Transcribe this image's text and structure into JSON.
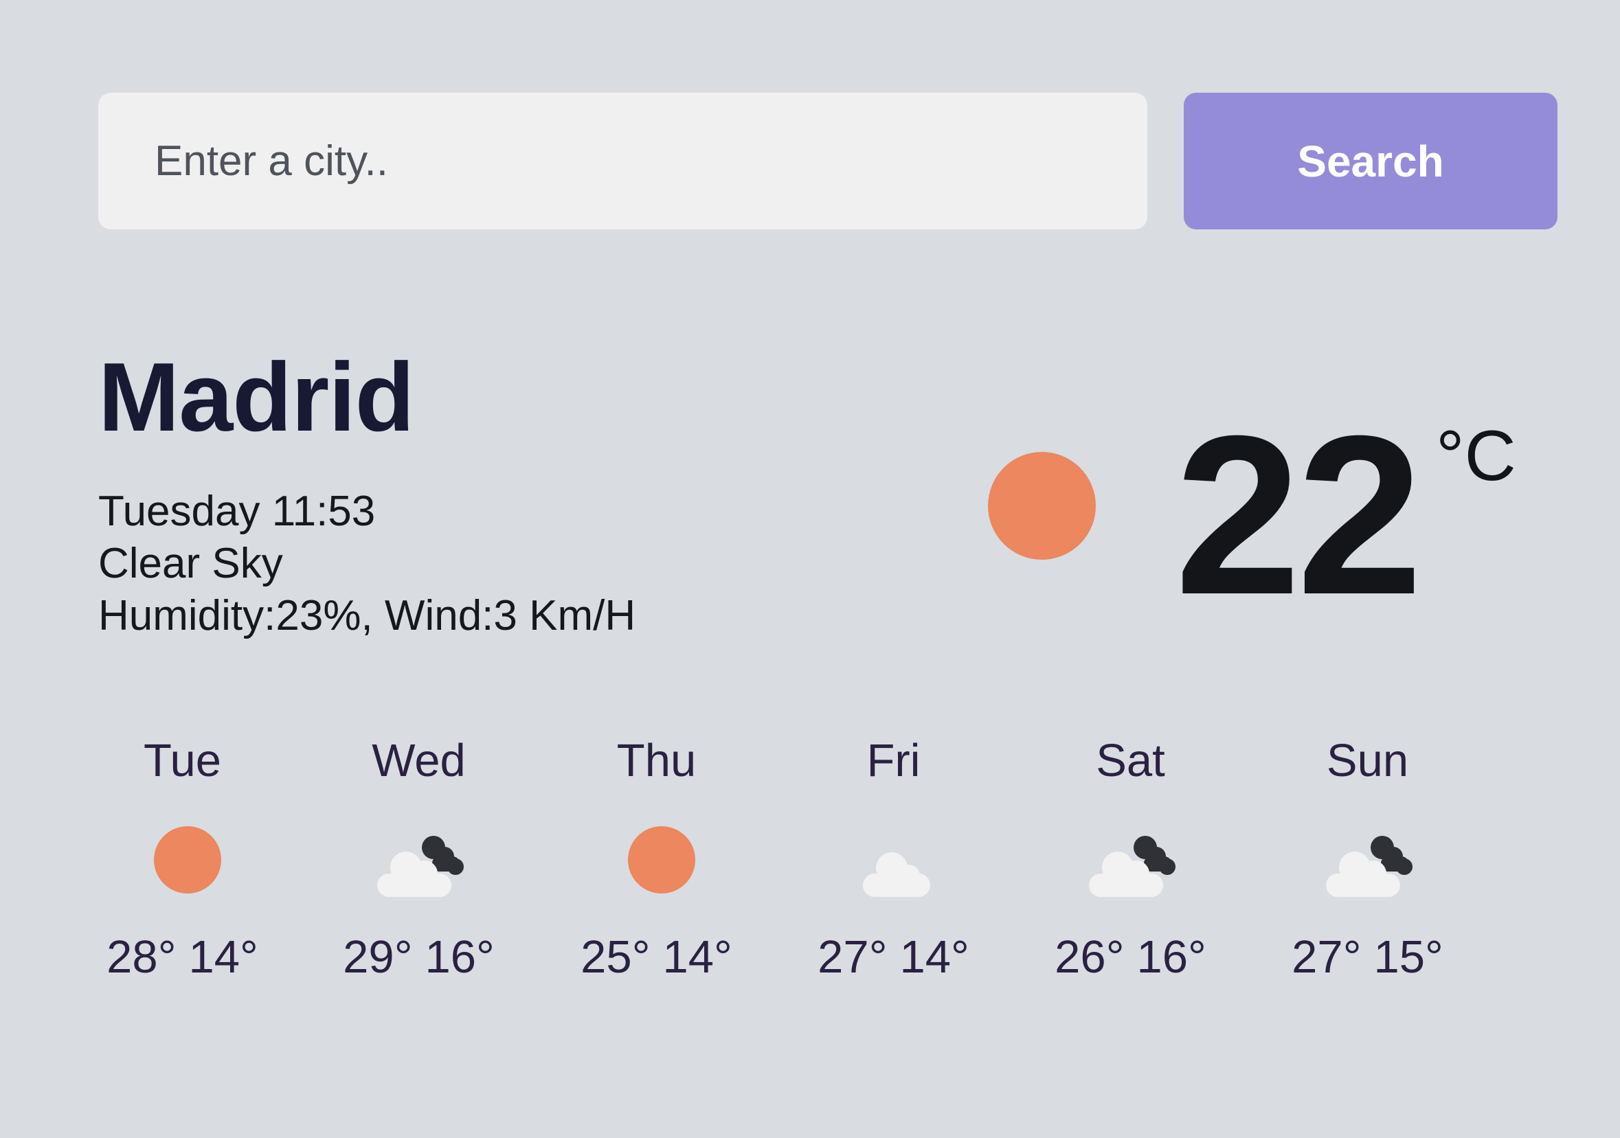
{
  "search": {
    "placeholder": "Enter a city..",
    "button_label": "Search"
  },
  "current": {
    "city": "Madrid",
    "datetime": "Tuesday 11:53",
    "condition": "Clear Sky",
    "conditions_detail": "Humidity:23%, Wind:3 Km/H",
    "temperature": "22",
    "unit": "°C",
    "icon": "sun-icon"
  },
  "forecast": [
    {
      "day": "Tue",
      "max": "28°",
      "min": "14°",
      "icon": "sun-icon"
    },
    {
      "day": "Wed",
      "max": "29°",
      "min": "16°",
      "icon": "cloudy-icon"
    },
    {
      "day": "Thu",
      "max": "25°",
      "min": "14°",
      "icon": "sun-icon"
    },
    {
      "day": "Fri",
      "max": "27°",
      "min": "14°",
      "icon": "cloud-icon"
    },
    {
      "day": "Sat",
      "max": "26°",
      "min": "16°",
      "icon": "cloudy-icon"
    },
    {
      "day": "Sun",
      "max": "27°",
      "min": "15°",
      "icon": "cloudy-icon"
    }
  ],
  "colors": {
    "background": "#d9dce1",
    "accent": "#958cd9",
    "sun": "#ec875f",
    "text_dark": "#181933"
  }
}
